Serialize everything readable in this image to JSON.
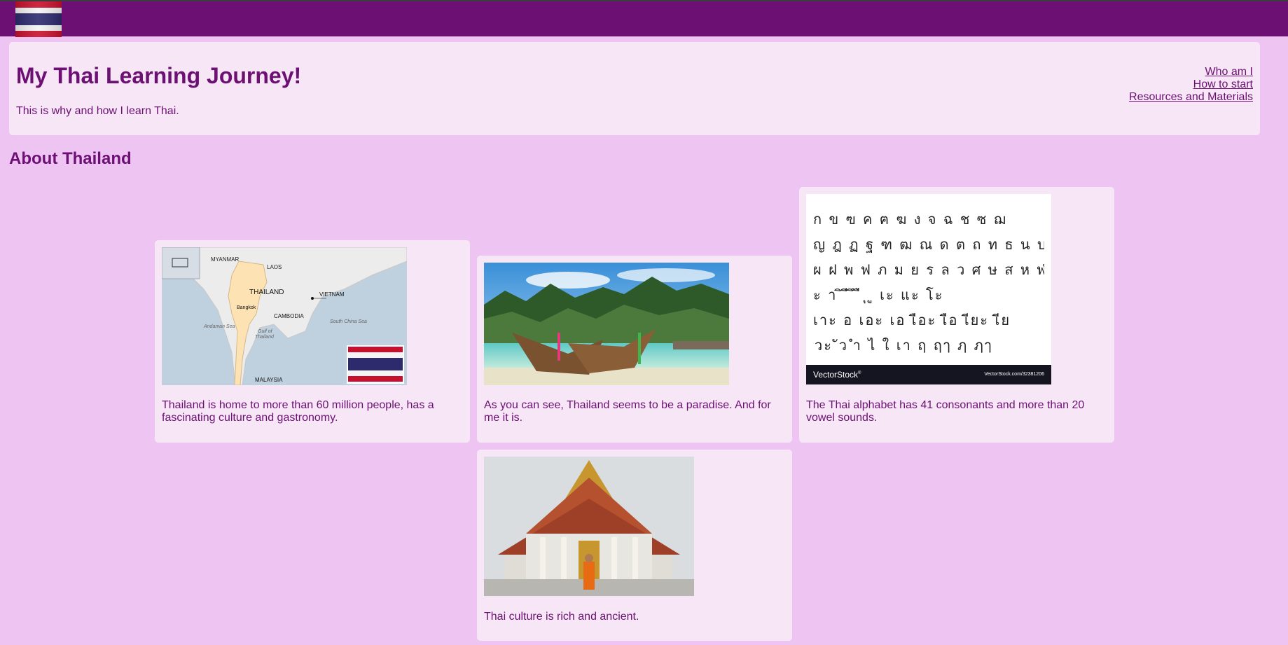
{
  "topbar": {
    "flag_name": "Thailand flag"
  },
  "header": {
    "title": "My Thai Learning Journey!",
    "subtitle": "This is why and how I learn Thai.",
    "nav": [
      "Who am I",
      "How to start",
      "Resources and Materials"
    ]
  },
  "section": {
    "title": "About Thailand"
  },
  "cards": [
    {
      "caption": "Thailand is home to more than 60 million people, has a fascinating culture and gastronomy.",
      "map_labels": {
        "myanmar": "MYANMAR",
        "laos": "LAOS",
        "thailand": "THAILAND",
        "vietnam": "VIETNAM",
        "bangkok": "Bangkok",
        "cambodia": "CAMBODIA",
        "andaman": "Andaman Sea",
        "gulf": "Gulf of",
        "gulf2": "Thailand",
        "scs": "South China Sea",
        "malaysia": "MALAYSIA"
      }
    },
    {
      "caption": "As you can see, Thailand seems to be a paradise. And for me it is."
    },
    {
      "caption": "The Thai alphabet has 41 consonants and more than 20 vowel sounds.",
      "alphabet_rows": [
        "ก ข ฃ ค ฅ ฆ ง จ ฉ ช ซ ฌ",
        "ญ ฎ ฏ ฐ ฑ ฒ ณ ด ต ถ ท ธ น บ ป",
        "ผ ฝ พ ฟ ภ ม ย ร ล ว ศ ษ ส ห ฬ อ ฮ",
        "ะ า ิ ี ึ ื ุ ู เะ แะ โะ",
        "เาะ อ เอะ เอ เือะ เือ เียะ เีย",
        "ัวะ ัว ำ ไ ใ เา ฤ ฤๅ ฦ ฦๅ"
      ],
      "brand": "VectorStock",
      "brand_mark": "®",
      "image_id": "VectorStock.com/32381206"
    },
    {
      "caption": "Thai culture is rich and ancient."
    }
  ],
  "colors": {
    "background": "#eec4f2",
    "topbar": "#6d1074",
    "card": "#f6e6f6",
    "text": "#6d1074"
  }
}
